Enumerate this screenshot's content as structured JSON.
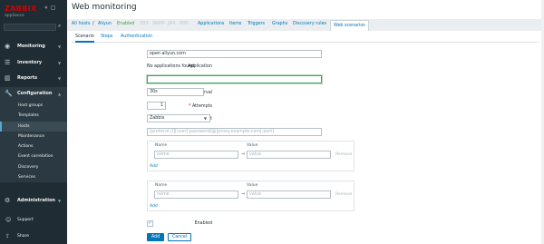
{
  "sidebar": {
    "logo": "ZABBIX",
    "appliance": "appliance",
    "menu": [
      {
        "label": "Monitoring",
        "icon": "eye-icon"
      },
      {
        "label": "Inventory",
        "icon": "list-icon"
      },
      {
        "label": "Reports",
        "icon": "chart-icon"
      },
      {
        "label": "Configuration",
        "icon": "wrench-icon"
      }
    ],
    "config_sub": [
      "Host groups",
      "Templates",
      "Hosts",
      "Maintenance",
      "Actions",
      "Event correlation",
      "Discovery",
      "Services"
    ],
    "admin": "Administration",
    "support": "Support",
    "share": "Share"
  },
  "page": {
    "title": "Web monitoring"
  },
  "navbar": {
    "all_hosts": "All hosts",
    "sep": "/",
    "host": "Aliyun",
    "enabled": "Enabled",
    "zbx": "ZBX",
    "snmp": "SNMP",
    "jmx": "JMX",
    "ipmi": "IPMI",
    "applications": "Applications",
    "items": "Items",
    "triggers": "Triggers",
    "graphs": "Graphs",
    "discovery_rules": "Discovery rules",
    "web_scenarios": "Web scenarios"
  },
  "tabs": [
    "Scenario",
    "Steps",
    "Authentication"
  ],
  "form": {
    "name_label": "Name",
    "name_value": "open aliyun.com",
    "application_label": "Application",
    "application_value": "No applications found",
    "new_application_label": "New application",
    "update_interval_label": "Update interval",
    "update_interval_value": "30s",
    "attempts_label": "Attempts",
    "attempts_value": "1",
    "agent_label": "Agent",
    "agent_value": "Zabbix",
    "http_proxy_label": "HTTP proxy",
    "http_proxy_placeholder": "[protocol://][user[:password]@]proxy.example.com[:port]",
    "variables_label": "Variables",
    "headers_label": "Headers",
    "col_name": "Name",
    "col_value": "Value",
    "name_placeholder": "name",
    "value_placeholder": "value",
    "arrow": "⇒",
    "remove": "Remove",
    "add": "Add",
    "enabled_label": "Enabled",
    "add_button": "Add",
    "cancel_button": "Cancel"
  }
}
